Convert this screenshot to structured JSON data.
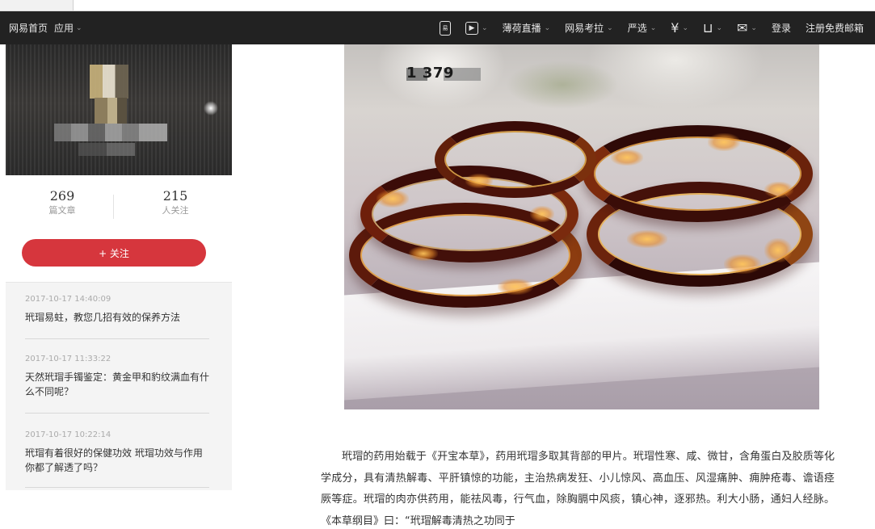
{
  "topbar": {
    "home_label": "网易首页",
    "apps_label": "应用",
    "items": [
      {
        "label": "",
        "icon": "phone-app-icon",
        "sub": "易"
      },
      {
        "label": "",
        "icon": "video-play-icon"
      },
      {
        "label": "薄荷直播"
      },
      {
        "label": "网易考拉"
      },
      {
        "label": "严选"
      },
      {
        "label": "",
        "icon": "yen-icon"
      },
      {
        "label": "",
        "icon": "cart-icon"
      },
      {
        "label": "",
        "icon": "mail-icon"
      }
    ],
    "login_label": "登录",
    "register_label": "注册免费邮箱"
  },
  "sidebar": {
    "stats": [
      {
        "value": "269",
        "label": "篇文章"
      },
      {
        "value": "215",
        "label": "人关注"
      }
    ],
    "follow_label": "+ 关注",
    "history": [
      {
        "time": "2017-10-17 14:40:09",
        "title": "玳瑁易蛀，教您几招有效的保养方法"
      },
      {
        "time": "2017-10-17 11:33:22",
        "title": "天然玳瑁手镯鉴定：黄金甲和豹纹满血有什么不同呢？"
      },
      {
        "time": "2017-10-17 10:22:14",
        "title": "玳瑁有着很好的保健功效 玳瑁功效与作用你都了解透了吗？"
      }
    ]
  },
  "photo": {
    "watermark": "1       379"
  },
  "article": {
    "paragraph": "玳瑁的药用始载于《开宝本草》，药用玳瑁多取其背部的甲片。玳瑁性寒、咸、微甘，含角蛋白及胶质等化学成分，具有清热解毒、平肝镇惊的功能，主治热病发狂、小儿惊风、高血压、风湿痛肿、痈肿疮毒、谵语痉厥等症。玳瑁的肉亦供药用，能祛风毒，行气血，除胸膈中风痰，镇心神，逐邪热。利大小肠，通妇人经脉。《本草纲目》曰：“玳瑁解毒清热之功同于"
  }
}
